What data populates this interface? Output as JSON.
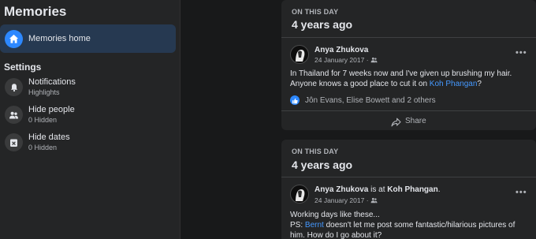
{
  "sidebar": {
    "title": "Memories",
    "home": {
      "label": "Memories home",
      "icon": "home-icon"
    },
    "settings_heading": "Settings",
    "items": [
      {
        "label": "Notifications",
        "sub": "Highlights",
        "icon": "bell-icon"
      },
      {
        "label": "Hide people",
        "sub": "0 Hidden",
        "icon": "people-icon"
      },
      {
        "label": "Hide dates",
        "sub": "0 Hidden",
        "icon": "calendar-x-icon"
      }
    ]
  },
  "posts": [
    {
      "on_this_day": "ON THIS DAY",
      "time_ago": "4 years ago",
      "author": "Anya Zhukova",
      "date": "24 January 2017 ·",
      "text_1": "In Thailand for 7 weeks now and I've given up brushing my hair.",
      "text_2": "Anyone knows a good place to cut it on ",
      "text_link": "Koh Phangan",
      "text_end": "?",
      "reactions": "Jôn Evans, Elise Bowett and 2 others",
      "share": "Share"
    },
    {
      "on_this_day": "ON THIS DAY",
      "time_ago": "4 years ago",
      "author": "Anya Zhukova",
      "author_rest": " is at ",
      "place": "Koh Phangan",
      "place_end": ".",
      "date": "24 January 2017 ·",
      "text_1": "Working days like these...",
      "text_2a": "PS: ",
      "text_link": "Bernt",
      "text_2b": " doesn't let me post some fantastic/hilarious pictures of",
      "text_3": "him. How do I go about it?"
    }
  ],
  "colors": {
    "accent": "#2d88ff",
    "link": "#4599ff",
    "card": "#242526",
    "background": "#18191a"
  }
}
